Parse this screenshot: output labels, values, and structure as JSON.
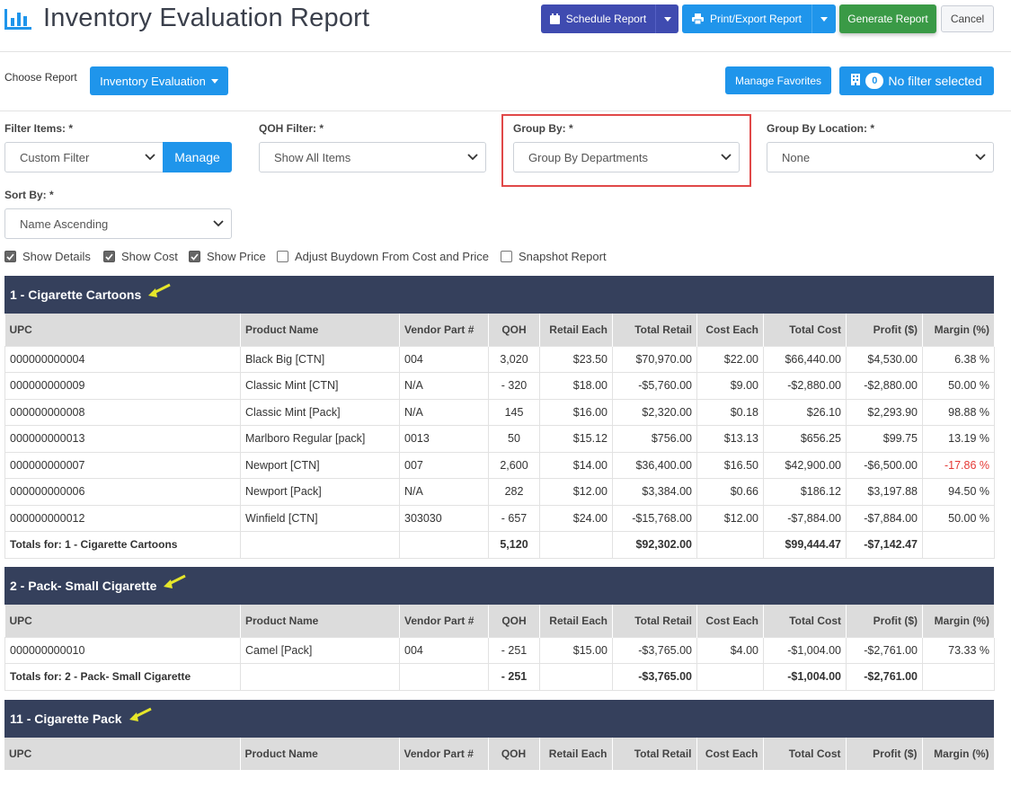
{
  "header": {
    "title": "Inventory Evaluation Report",
    "schedule_label": "Schedule Report",
    "print_label": "Print/Export Report",
    "generate_label": "Generate Report",
    "cancel_label": "Cancel"
  },
  "choose": {
    "label": "Choose Report",
    "report_value": "Inventory Evaluation",
    "favorites_label": "Manage Favorites",
    "filter_count": "0",
    "filter_label": "No filter selected"
  },
  "filters": {
    "filter_items_label": "Filter Items: *",
    "filter_items_value": "Custom Filter",
    "manage_label": "Manage",
    "qoh_label": "QOH Filter: *",
    "qoh_value": "Show All Items",
    "group_by_label": "Group By: *",
    "group_by_value": "Group By Departments",
    "group_loc_label": "Group By Location: *",
    "group_loc_value": "None",
    "sort_label": "Sort By: *",
    "sort_value": "Name Ascending"
  },
  "options": {
    "show_details": "Show Details",
    "show_cost": "Show Cost",
    "show_price": "Show Price",
    "adjust_buydown": "Adjust Buydown From Cost and Price",
    "snapshot": "Snapshot Report"
  },
  "columns": [
    "UPC",
    "Product Name",
    "Vendor Part #",
    "QOH",
    "Retail Each",
    "Total Retail",
    "Cost Each",
    "Total Cost",
    "Profit ($)",
    "Margin (%)"
  ],
  "sections": [
    {
      "title": "1 - Cigarette Cartoons",
      "rows": [
        [
          "000000000004",
          "Black Big [CTN]",
          "004",
          "3,020",
          "$23.50",
          "$70,970.00",
          "$22.00",
          "$66,440.00",
          "$4,530.00",
          "6.38 %"
        ],
        [
          "000000000009",
          "Classic Mint [CTN]",
          "N/A",
          "- 320",
          "$18.00",
          "-$5,760.00",
          "$9.00",
          "-$2,880.00",
          "-$2,880.00",
          "50.00 %"
        ],
        [
          "000000000008",
          "Classic Mint [Pack]",
          "N/A",
          "145",
          "$16.00",
          "$2,320.00",
          "$0.18",
          "$26.10",
          "$2,293.90",
          "98.88 %"
        ],
        [
          "000000000013",
          "Marlboro Regular [pack]",
          "0013",
          "50",
          "$15.12",
          "$756.00",
          "$13.13",
          "$656.25",
          "$99.75",
          "13.19 %"
        ],
        [
          "000000000007",
          "Newport [CTN]",
          "007",
          "2,600",
          "$14.00",
          "$36,400.00",
          "$16.50",
          "$42,900.00",
          "-$6,500.00",
          "-17.86 %"
        ],
        [
          "000000000006",
          "Newport [Pack]",
          "N/A",
          "282",
          "$12.00",
          "$3,384.00",
          "$0.66",
          "$186.12",
          "$3,197.88",
          "94.50 %"
        ],
        [
          "000000000012",
          "Winfield [CTN]",
          "303030",
          "- 657",
          "$24.00",
          "-$15,768.00",
          "$12.00",
          "-$7,884.00",
          "-$7,884.00",
          "50.00 %"
        ]
      ],
      "totals": {
        "label": "Totals for: 1 - Cigarette Cartoons",
        "qoh": "5,120",
        "total_retail": "$92,302.00",
        "total_cost": "$99,444.47",
        "profit": "-$7,142.47"
      }
    },
    {
      "title": "2 - Pack- Small Cigarette",
      "rows": [
        [
          "000000000010",
          "Camel [Pack]",
          "004",
          "- 251",
          "$15.00",
          "-$3,765.00",
          "$4.00",
          "-$1,004.00",
          "-$2,761.00",
          "73.33 %"
        ]
      ],
      "totals": {
        "label": "Totals for: 2 - Pack- Small Cigarette",
        "qoh": "- 251",
        "total_retail": "-$3,765.00",
        "total_cost": "-$1,004.00",
        "profit": "-$2,761.00"
      }
    },
    {
      "title": "11 - Cigarette Pack",
      "rows": [],
      "totals": null
    }
  ],
  "colors": {
    "primary": "#1f95eb",
    "schedule": "#3f4bb0",
    "generate": "#3a9a46",
    "section_header": "#35405c",
    "negative": "#e53935",
    "highlight_border": "#e04848",
    "annotation_arrow": "#e6e62a"
  }
}
